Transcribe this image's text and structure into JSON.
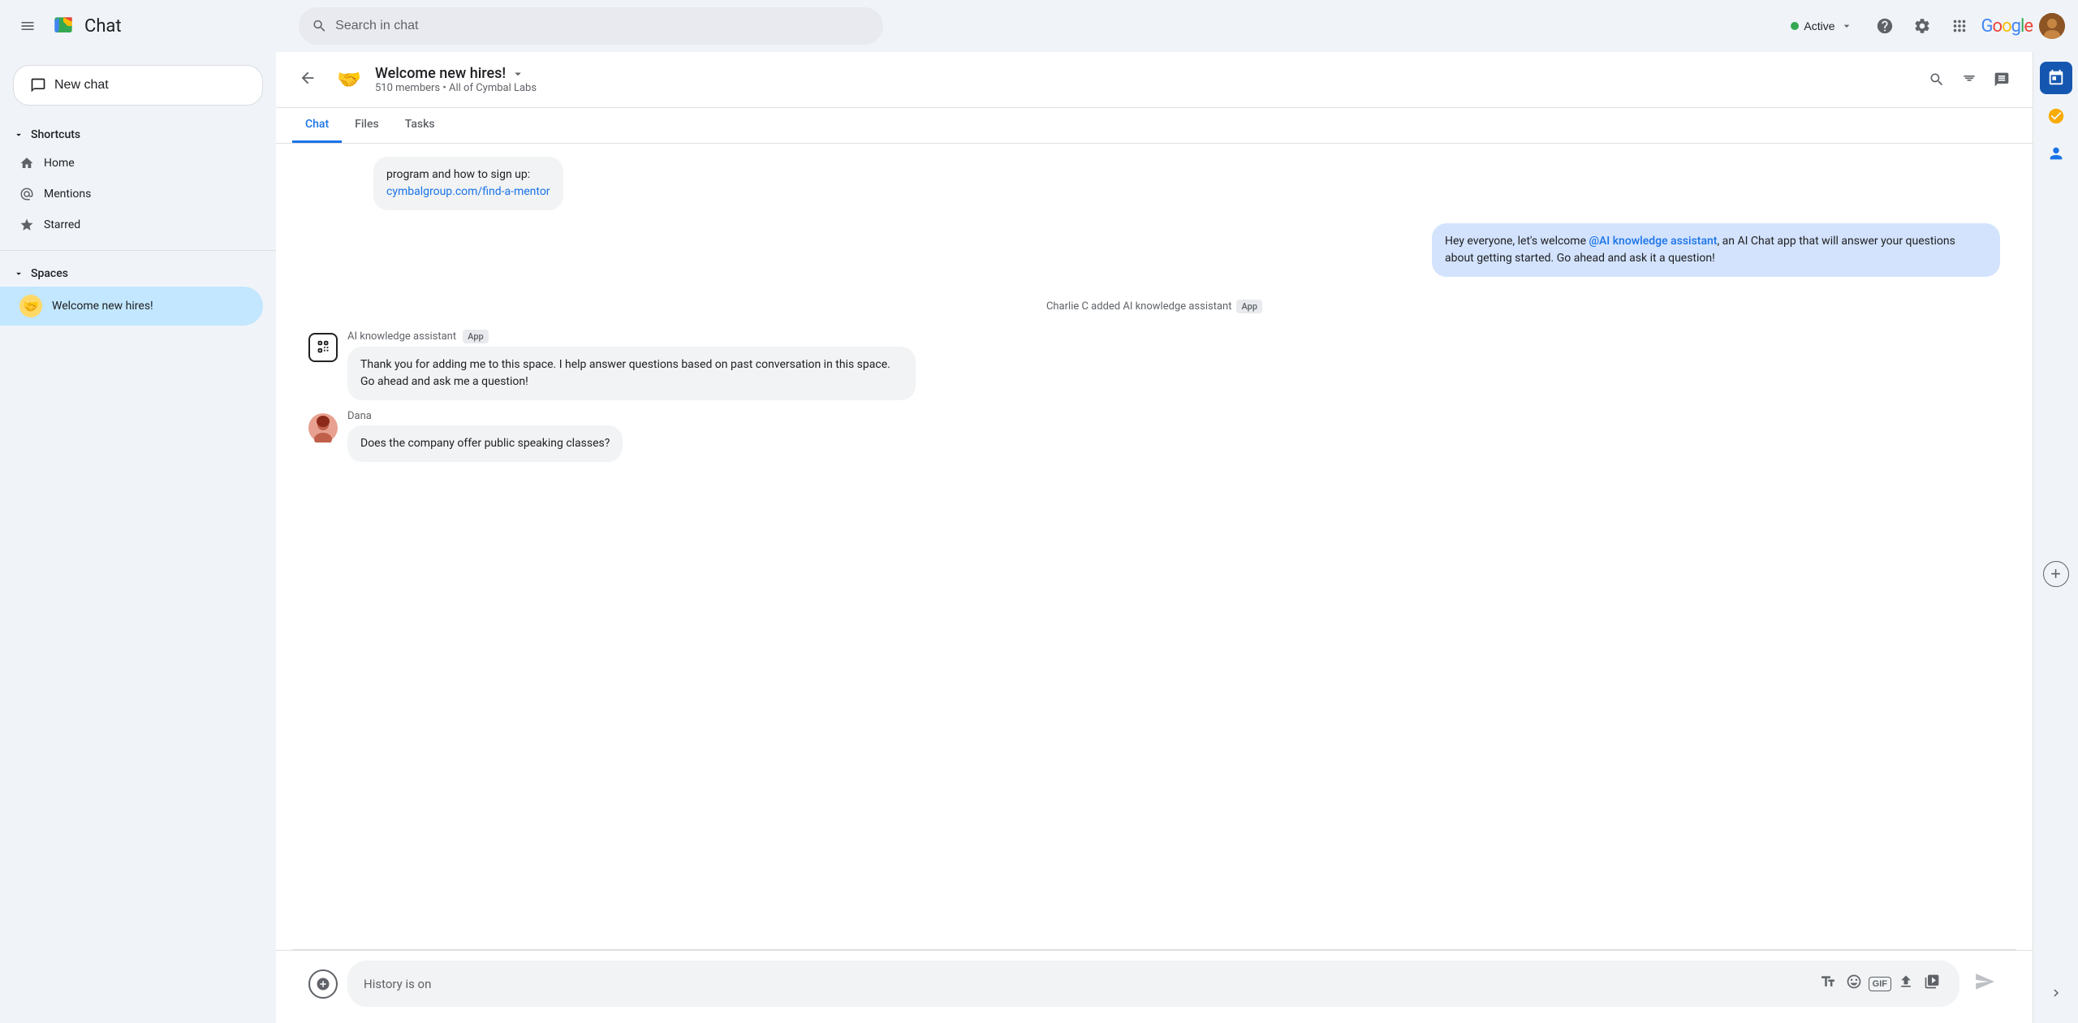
{
  "topbar": {
    "menu_icon": "☰",
    "app_name": "Chat",
    "search_placeholder": "Search in chat",
    "status": "Active",
    "help_icon": "?",
    "settings_icon": "⚙",
    "grid_icon": "⋮⋮⋮",
    "google_text": "Google"
  },
  "sidebar": {
    "new_chat_label": "New chat",
    "shortcuts_label": "Shortcuts",
    "home_label": "Home",
    "mentions_label": "Mentions",
    "starred_label": "Starred",
    "spaces_label": "Spaces",
    "active_space": "Welcome new hires!",
    "active_space_emoji": "🤝"
  },
  "chat_header": {
    "space_name": "Welcome new hires!",
    "member_count": "510 members",
    "org_name": "All of Cymbal Labs",
    "emoji": "🤝"
  },
  "tabs": [
    {
      "label": "Chat",
      "active": true
    },
    {
      "label": "Files",
      "active": false
    },
    {
      "label": "Tasks",
      "active": false
    }
  ],
  "messages": [
    {
      "id": "msg1",
      "type": "partial",
      "text_part1": "program and how to sign up:",
      "link_text": "cymbalgroup.com/find-a-mentor",
      "link_url": "#"
    },
    {
      "id": "msg2",
      "type": "blue_bubble",
      "text": "Hey everyone, let's welcome @AI knowledge assistant, an AI Chat app that will answer your questions about getting started.  Go ahead and ask it a question!"
    },
    {
      "id": "msg3",
      "type": "system",
      "text": "Charlie C added AI knowledge assistant",
      "badge": "App"
    },
    {
      "id": "msg4",
      "type": "bot",
      "sender": "AI knowledge assistant",
      "sender_badge": "App",
      "text": "Thank you for adding me to this space. I help answer questions based on past conversation in this space. Go ahead and ask me a question!"
    },
    {
      "id": "msg5",
      "type": "user",
      "sender": "Dana",
      "avatar": "👩",
      "text": "Does the company offer public speaking classes?"
    }
  ],
  "input": {
    "placeholder": "History is on",
    "attach_icon": "+",
    "text_format_icon": "A",
    "emoji_icon": "🙂",
    "gif_icon": "GIF",
    "upload_icon": "⬆",
    "video_icon": "📹",
    "send_icon": "▶"
  },
  "right_sidebar": {
    "calendar_icon": "📅",
    "tasks_icon": "✓",
    "contacts_icon": "👤",
    "expand_icon": "+"
  }
}
